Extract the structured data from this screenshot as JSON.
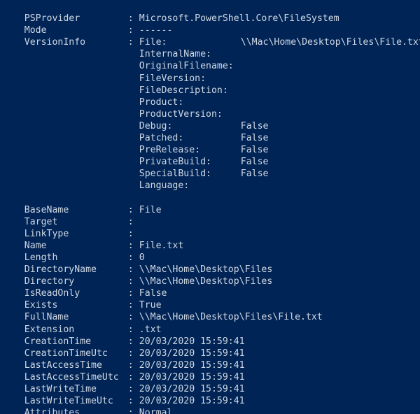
{
  "console": {
    "background_color": "#012456",
    "text_color": "#cfd8e3",
    "separator": ":"
  },
  "output": {
    "header_rows": [
      {
        "name": "PSProvider",
        "value": "Microsoft.PowerShell.Core\\FileSystem"
      },
      {
        "name": "Mode",
        "value": "------"
      }
    ],
    "version_info": {
      "name": "VersionInfo",
      "rows": [
        {
          "label": "File:",
          "value": "\\\\Mac\\Home\\Desktop\\Files\\File.txt"
        },
        {
          "label": "InternalName:",
          "value": ""
        },
        {
          "label": "OriginalFilename:",
          "value": ""
        },
        {
          "label": "FileVersion:",
          "value": ""
        },
        {
          "label": "FileDescription:",
          "value": ""
        },
        {
          "label": "Product:",
          "value": ""
        },
        {
          "label": "ProductVersion:",
          "value": ""
        },
        {
          "label": "Debug:",
          "value": "False"
        },
        {
          "label": "Patched:",
          "value": "False"
        },
        {
          "label": "PreRelease:",
          "value": "False"
        },
        {
          "label": "PrivateBuild:",
          "value": "False"
        },
        {
          "label": "SpecialBuild:",
          "value": "False"
        },
        {
          "label": "Language:",
          "value": ""
        }
      ]
    },
    "property_rows": [
      {
        "name": "BaseName",
        "value": "File"
      },
      {
        "name": "Target",
        "value": ""
      },
      {
        "name": "LinkType",
        "value": ""
      },
      {
        "name": "Name",
        "value": "File.txt"
      },
      {
        "name": "Length",
        "value": "0"
      },
      {
        "name": "DirectoryName",
        "value": "\\\\Mac\\Home\\Desktop\\Files"
      },
      {
        "name": "Directory",
        "value": "\\\\Mac\\Home\\Desktop\\Files"
      },
      {
        "name": "IsReadOnly",
        "value": "False"
      },
      {
        "name": "Exists",
        "value": "True"
      },
      {
        "name": "FullName",
        "value": "\\\\Mac\\Home\\Desktop\\Files\\File.txt"
      },
      {
        "name": "Extension",
        "value": ".txt"
      },
      {
        "name": "CreationTime",
        "value": "20/03/2020 15:59:41"
      },
      {
        "name": "CreationTimeUtc",
        "value": "20/03/2020 15:59:41"
      },
      {
        "name": "LastAccessTime",
        "value": "20/03/2020 15:59:41"
      },
      {
        "name": "LastAccessTimeUtc",
        "value": "20/03/2020 15:59:41"
      },
      {
        "name": "LastWriteTime",
        "value": "20/03/2020 15:59:41"
      },
      {
        "name": "LastWriteTimeUtc",
        "value": "20/03/2020 15:59:41"
      },
      {
        "name": "Attributes",
        "value": "Normal"
      }
    ]
  }
}
